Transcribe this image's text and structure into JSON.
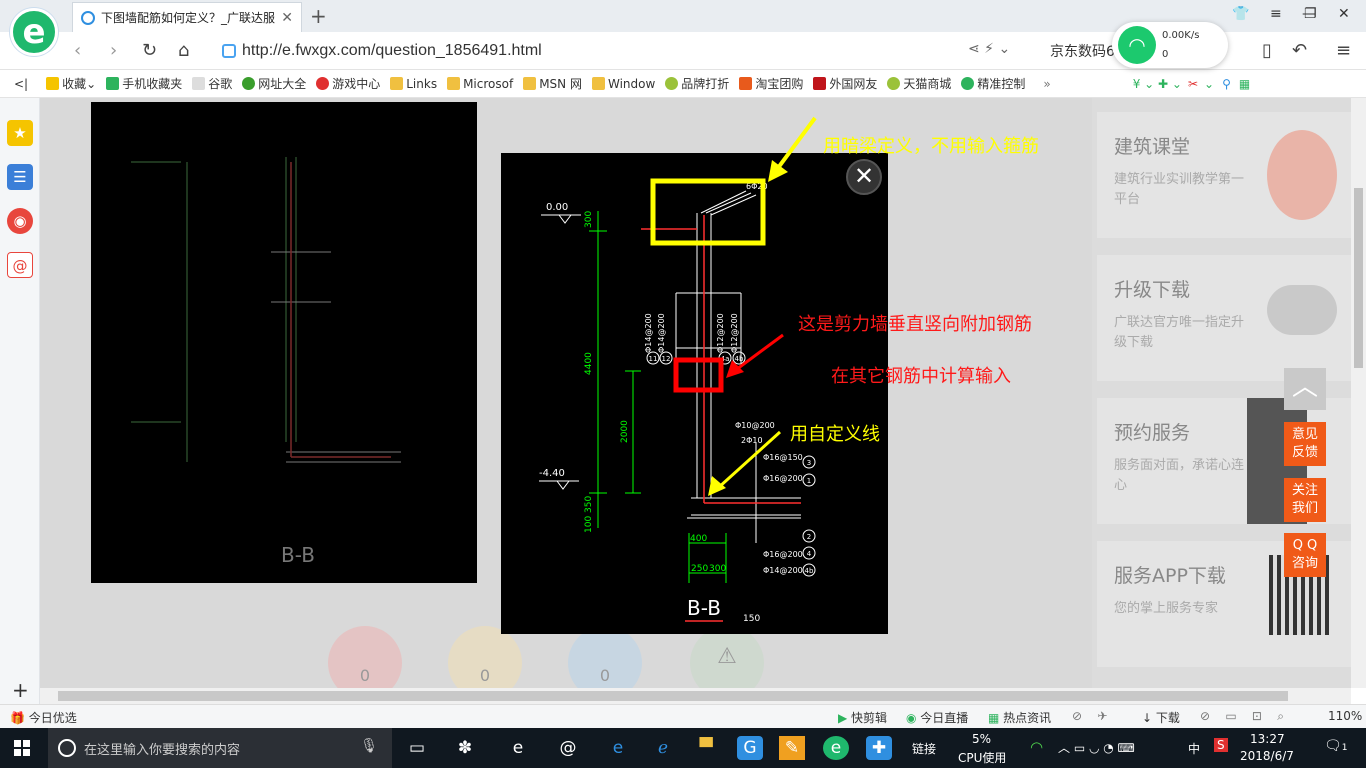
{
  "browser": {
    "tab_title": "下图墙配筋如何定义？_广联达服",
    "url": "http://e.fwxgx.com/question_1856491.html",
    "search_link": "京东数码6",
    "net_speed": "0.00K/s",
    "net_count": "0"
  },
  "bookmarks": [
    "收藏",
    "手机收藏夹",
    "谷歌",
    "网址大全",
    "游戏中心",
    "Links",
    "Microsof",
    "MSN 网",
    "Window",
    "品牌打折",
    "淘宝团购",
    "外国网友",
    "天猫商城",
    "精准控制"
  ],
  "right_cards": [
    {
      "title": "建筑课堂",
      "desc": "建筑行业实训教学第一平台"
    },
    {
      "title": "升级下载",
      "desc": "广联达官方唯一指定升级下载"
    },
    {
      "title": "预约服务",
      "desc": "服务面对面，承诺心连心"
    },
    {
      "title": "服务APP下载",
      "desc": "您的掌上服务专家"
    }
  ],
  "float_buttons": [
    "意见\n反馈",
    "关注\n我们",
    "Q Q\n咨询"
  ],
  "counters": [
    "0",
    "0",
    "0"
  ],
  "drawing": {
    "title": "B-B",
    "scale": "150",
    "elev_top": "0.00",
    "elev_bottom": "-4.40",
    "dim_total": "4400",
    "dim_2000": "2000",
    "dim_300": "300",
    "dim_100_350": "100 350",
    "dim_250": "250",
    "dim_300b": "300",
    "dim_400": "400",
    "top_bar": "6Φ20",
    "bar_a": "Φ14@200",
    "bar_b": "Φ14@200",
    "bar_c": "Φ12@200",
    "bar_d": "Φ12@200",
    "bar_e": "Φ10@200",
    "bar_f": "2Φ10",
    "bar_g": "Φ16@150",
    "bar_h": "Φ16@200",
    "bar_i": "Φ16@200",
    "bar_j": "Φ14@200",
    "tags": [
      "3",
      "1",
      "2",
      "4",
      "4b",
      "11",
      "12",
      "4a",
      "4b"
    ]
  },
  "annotations": {
    "a1": "用暗梁定义，不用输入箍筋",
    "a2": "这是剪力墙垂直竖向附加钢筋",
    "a3": "在其它钢筋中计算输入",
    "a4": "用自定义线"
  },
  "statusbar": {
    "left": "今日优选",
    "items": [
      "快剪辑",
      "今日直播",
      "热点资讯",
      "下载"
    ],
    "zoom": "110%"
  },
  "taskbar": {
    "search_placeholder": "在这里输入你要搜索的内容",
    "link_label": "链接",
    "cpu_pct": "5%",
    "cpu_label": "CPU使用",
    "ime": "中",
    "time": "13:27",
    "date": "2018/6/7",
    "notif": "1"
  },
  "colors": {
    "accent_green": "#1fb86d",
    "highlight_yellow": "#ffff00",
    "highlight_red": "#ff0000",
    "cad_green": "#00ff00",
    "float_orange": "#f05a18"
  }
}
